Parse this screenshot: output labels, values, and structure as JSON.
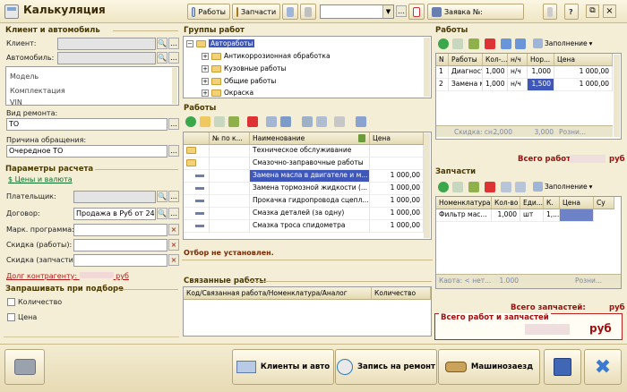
{
  "window": {
    "title": "Калькуляция",
    "toolbar": {
      "works_label": "Работы",
      "parts_label": "Запчасти",
      "search_value": "",
      "order_label": "Заявка №:",
      "order_value": ""
    }
  },
  "left": {
    "client_section": "Клиент и автомобиль",
    "client_label": "Клиент:",
    "car_label": "Автомобиль:",
    "model_label": "Модель",
    "config_label": "Комплектация",
    "config_label2": "VIN",
    "repair_type_label": "Вид ремонта:",
    "repair_type_value": "ТО",
    "reason_label": "Причина обращения:",
    "reason_value": "Очередное ТО",
    "calc_section": "Параметры расчета",
    "prices_link": "Цены и валюта",
    "payer_label": "Плательщик:",
    "contract_label": "Договор:",
    "contract_value": "Продажа в Руб от 24.09.",
    "mark_label": "Марк. программа:",
    "disc_works_label": "Скидка (работы):",
    "disc_parts_label": "Скидка (запчасти):",
    "debt_label": "Долг контрагенту:",
    "debt_currency": "руб",
    "ask_section": "Запрашивать при подборе",
    "qty_label": "Количество",
    "price_label": "Цена"
  },
  "groups": {
    "title": "Группы работ",
    "root": "Автоработы",
    "items": [
      "Антикоррозионная обработка",
      "Кузовные работы",
      "Общие работы",
      "Окраска"
    ]
  },
  "works_catalog": {
    "title": "Работы",
    "headers": [
      "№ по к...",
      "Наименование",
      "Цена"
    ],
    "rows": [
      {
        "name": "Техническое обслуживание",
        "price": "",
        "folder": true
      },
      {
        "name": "Смазочно-заправочные работы",
        "price": "",
        "folder": true
      },
      {
        "name": "Замена масла в двигателе и м...",
        "price": "1 000,00",
        "folder": false,
        "selected": true
      },
      {
        "name": "Замена тормозной жидкости (...",
        "price": "1 000,00",
        "folder": false
      },
      {
        "name": "Прокачка гидропровода сцепл...",
        "price": "1 000,00",
        "folder": false
      },
      {
        "name": "Смазка деталей (за одну)",
        "price": "1 000,00",
        "folder": false
      },
      {
        "name": "Смазка троса спидометра",
        "price": "1 000,00",
        "folder": false
      }
    ],
    "status": "Отбор не установлен."
  },
  "related": {
    "title": "Связанные работы",
    "headers": [
      "Код/Связанная работа/Номенклатура/Аналог",
      "Количество"
    ]
  },
  "order_works": {
    "title": "Работы",
    "fill_label": "Заполнение",
    "headers": [
      "N",
      "Работы",
      "Кол-...",
      "н/ч",
      "Нор...",
      "Цена"
    ],
    "rows": [
      {
        "n": "1",
        "name": "Диагности...",
        "qty": "1,000",
        "unit": "н/ч",
        "norm": "1,000",
        "price": "1 000,00"
      },
      {
        "n": "2",
        "name": "Замена ма...",
        "qty": "1,000",
        "unit": "н/ч",
        "norm": "1,500",
        "price": "1 000,00"
      }
    ],
    "footer": [
      "Скидка: сн...",
      "2,000",
      "3,000",
      "Розни..."
    ],
    "total_label": "Всего работ:",
    "currency": "руб"
  },
  "order_parts": {
    "title": "Запчасти",
    "fill_label": "Заполнение",
    "headers": [
      "Номенклатура",
      "Кол-во",
      "Еди...",
      "К.",
      "Цена",
      "Су"
    ],
    "rows": [
      {
        "name": "Фильтр мас...",
        "qty": "1,000",
        "unit": "шт",
        "k": "1,..."
      }
    ],
    "footer": [
      "Карта: < нет...",
      "1,000",
      "Розни..."
    ],
    "total_label": "Всего запчастей:",
    "currency": "руб",
    "grand_label": "Всего работ и запчастей",
    "grand_currency": "руб"
  },
  "footer": {
    "clients_btn": "Клиенты и авто",
    "record_btn": "Запись на ремонт",
    "carcall_btn": "Машинозаезд"
  },
  "colors": {
    "accent": "#3f57b8",
    "section": "#4a3a00",
    "danger": "#a01010",
    "bg": "#f4eed7"
  }
}
